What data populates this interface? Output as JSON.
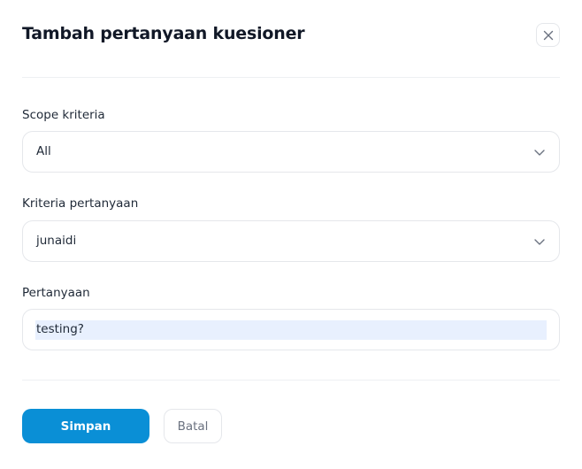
{
  "modal": {
    "title": "Tambah pertanyaan kuesioner"
  },
  "form": {
    "scope": {
      "label": "Scope kriteria",
      "value": "All"
    },
    "criteria": {
      "label": "Kriteria pertanyaan",
      "value": "junaidi"
    },
    "question": {
      "label": "Pertanyaan",
      "value": "testing?"
    }
  },
  "actions": {
    "save_label": "Simpan",
    "cancel_label": "Batal"
  },
  "colors": {
    "primary": "#0a8fd6",
    "border": "#e5e7eb",
    "selection": "#e8f0fe"
  },
  "icons": {
    "close": "close-icon",
    "chevron": "chevron-down-icon"
  }
}
